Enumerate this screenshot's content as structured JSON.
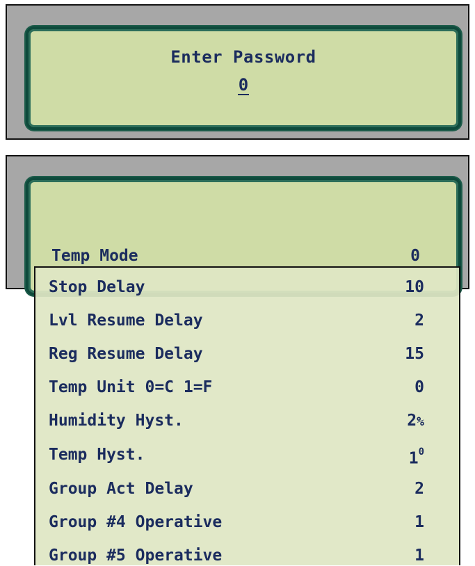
{
  "password_screen": {
    "title": "Enter Password",
    "value": "0"
  },
  "settings_screen": {
    "current": {
      "label": "Temp Mode",
      "value": "0"
    },
    "items": [
      {
        "label": "Stop Delay",
        "value": "10",
        "unit": ""
      },
      {
        "label": "Lvl Resume Delay",
        "value": "2",
        "unit": ""
      },
      {
        "label": "Reg Resume Delay",
        "value": "15",
        "unit": ""
      },
      {
        "label": "Temp Unit 0=C 1=F",
        "value": "0",
        "unit": ""
      },
      {
        "label": "Humidity Hyst.",
        "value": "2",
        "unit": "%"
      },
      {
        "label": "Temp Hyst.",
        "value": "1",
        "unit": "0"
      },
      {
        "label": "Group Act Delay",
        "value": "2",
        "unit": ""
      },
      {
        "label": "Group #4 Operative",
        "value": "1",
        "unit": ""
      },
      {
        "label": "Group #5 Operative",
        "value": "1",
        "unit": ""
      }
    ]
  },
  "colors": {
    "lcd_background": "#cfdca6",
    "lcd_border": "#0e4a3c",
    "text": "#1b2c5e",
    "bezel": "#a7a7a7"
  }
}
